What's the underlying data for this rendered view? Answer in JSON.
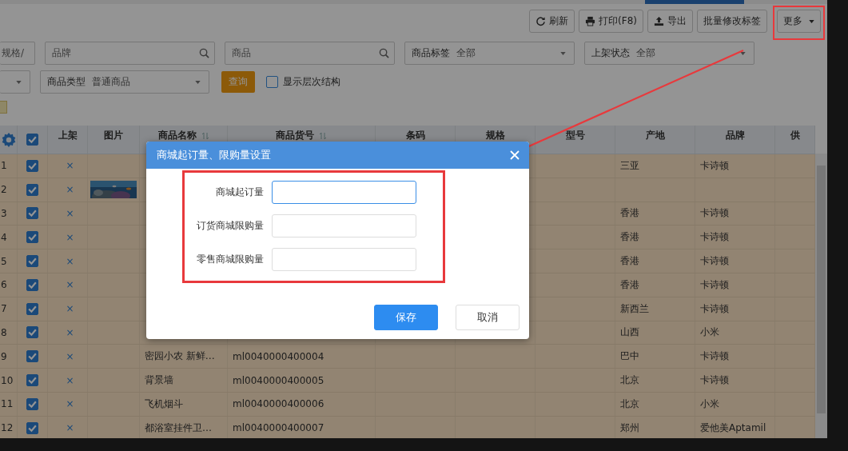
{
  "toolbar": {
    "buttons": [
      {
        "kind": "refresh",
        "label": "刷新",
        "highlighted": false
      },
      {
        "kind": "print",
        "label": "打印(F8)",
        "highlighted": false
      },
      {
        "kind": "export",
        "label": "导出",
        "highlighted": false
      },
      {
        "kind": "plain",
        "label": "批量修改标签",
        "highlighted": false
      },
      {
        "kind": "dropdown",
        "label": "更多",
        "highlighted": true
      }
    ]
  },
  "filters": {
    "row_1": [
      {
        "kind": "text",
        "placeholder": "规格/"
      },
      {
        "kind": "search",
        "placeholder": "品牌"
      },
      {
        "kind": "search",
        "placeholder": "商品"
      },
      {
        "kind": "select",
        "label": "商品标签",
        "value": "全部"
      },
      {
        "kind": "select",
        "label": "上架状态",
        "value": "全部"
      }
    ],
    "row_2": [
      {
        "kind": "select"
      },
      {
        "kind": "select",
        "label": "商品类型",
        "value": "普通商品"
      },
      {
        "kind": "button",
        "label": "查询"
      },
      {
        "kind": "checkbox",
        "label": "显示层次结构",
        "checked": false
      }
    ]
  },
  "table": {
    "all_checked": true,
    "columns": [
      {
        "label": "上架",
        "sortable": false
      },
      {
        "label": "图片",
        "sortable": false
      },
      {
        "label": "商品名称",
        "sortable": true
      },
      {
        "label": "商品货号",
        "sortable": true
      },
      {
        "label": "条码",
        "sortable": false
      },
      {
        "label": "规格",
        "sortable": false
      },
      {
        "label": "型号",
        "sortable": false
      },
      {
        "label": "产地",
        "sortable": false
      },
      {
        "label": "品牌",
        "sortable": false
      },
      {
        "label": "供",
        "sortable": false
      }
    ],
    "rows": [
      {
        "number": "1",
        "checked": true,
        "listed": "×",
        "origin": "三亚",
        "brand": "卡诗顿"
      },
      {
        "number": "2",
        "checked": true,
        "listed": "×",
        "picture": true
      },
      {
        "number": "3",
        "checked": true,
        "listed": "×",
        "origin": "香港",
        "brand": "卡诗顿"
      },
      {
        "number": "4",
        "checked": true,
        "listed": "×",
        "origin": "香港",
        "brand": "卡诗顿"
      },
      {
        "number": "5",
        "checked": true,
        "listed": "×",
        "origin": "香港",
        "brand": "卡诗顿"
      },
      {
        "number": "6",
        "checked": true,
        "listed": "×",
        "origin": "香港",
        "brand": "卡诗顿"
      },
      {
        "number": "7",
        "checked": true,
        "listed": "×",
        "origin": "新西兰",
        "brand": "卡诗顿"
      },
      {
        "number": "8",
        "checked": true,
        "listed": "×",
        "origin": "山西",
        "brand": "小米"
      },
      {
        "number": "9",
        "checked": true,
        "listed": "×",
        "name": "密园小农 新鲜…",
        "sku": "ml0040000400004",
        "origin": "巴中",
        "brand": "卡诗顿"
      },
      {
        "number": "10",
        "checked": true,
        "listed": "×",
        "name": "背景墙",
        "sku": "ml0040000400005",
        "origin": "北京",
        "brand": "卡诗顿"
      },
      {
        "number": "11",
        "checked": true,
        "listed": "×",
        "name": "飞机烟斗",
        "sku": "ml0040000400006",
        "origin": "北京",
        "brand": "小米"
      },
      {
        "number": "12",
        "checked": true,
        "listed": "×",
        "name": "都浴室挂件卫…",
        "sku": "ml0040000400007",
        "origin": "郑州",
        "brand": "爱他美Aptamil"
      }
    ]
  },
  "dialog": {
    "title": "商城起订量、限购量设置",
    "highlighted": true,
    "fields": [
      {
        "label": "商城起订量",
        "focused": true
      },
      {
        "label": "订货商城限购量",
        "focused": false
      },
      {
        "label": "零售商城限购量",
        "focused": false
      }
    ],
    "buttons": [
      {
        "label": "保存",
        "primary": true
      },
      {
        "label": "取消",
        "primary": false
      }
    ]
  }
}
